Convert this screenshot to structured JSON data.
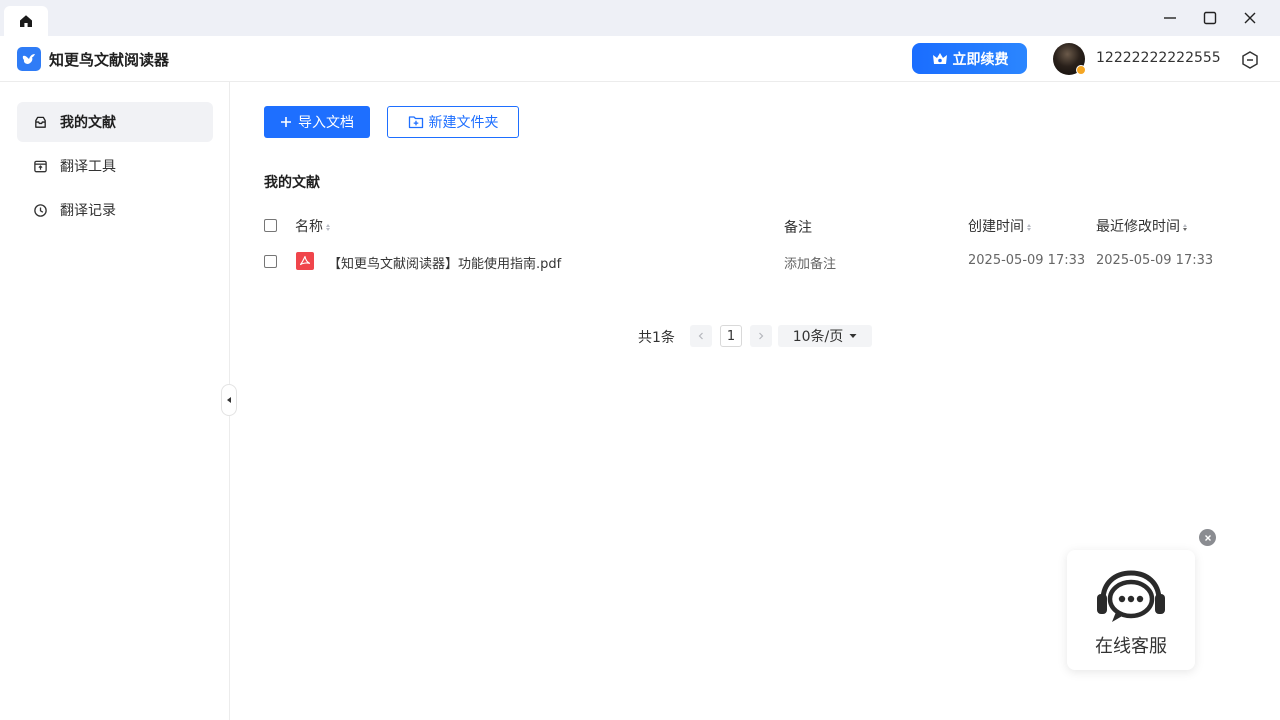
{
  "titlebar": {
    "home_tab": "home-icon"
  },
  "header": {
    "app_name": "知更鸟文献阅读器",
    "renew_label": "立即续费",
    "username": "12222222222555"
  },
  "sidebar": {
    "items": [
      {
        "label": "我的文献",
        "icon": "inbox-icon",
        "active": true
      },
      {
        "label": "翻译工具",
        "icon": "translate-icon",
        "active": false
      },
      {
        "label": "翻译记录",
        "icon": "clock-icon",
        "active": false
      }
    ]
  },
  "toolbar": {
    "import_label": "导入文档",
    "new_folder_label": "新建文件夹"
  },
  "section_title": "我的文献",
  "table": {
    "columns": [
      "名称",
      "备注",
      "创建时间",
      "最近修改时间"
    ],
    "rows": [
      {
        "name": "【知更鸟文献阅读器】功能使用指南.pdf",
        "note": "添加备注",
        "created": "2025-05-09 17:33",
        "modified": "2025-05-09 17:33"
      }
    ]
  },
  "pagination": {
    "total": "共1条",
    "current_page": "1",
    "page_size": "10条/页"
  },
  "support": {
    "label": "在线客服"
  },
  "colors": {
    "primary": "#1e6fff",
    "pdf": "#f0454b",
    "active_nav_bg": "#f1f2f5"
  }
}
